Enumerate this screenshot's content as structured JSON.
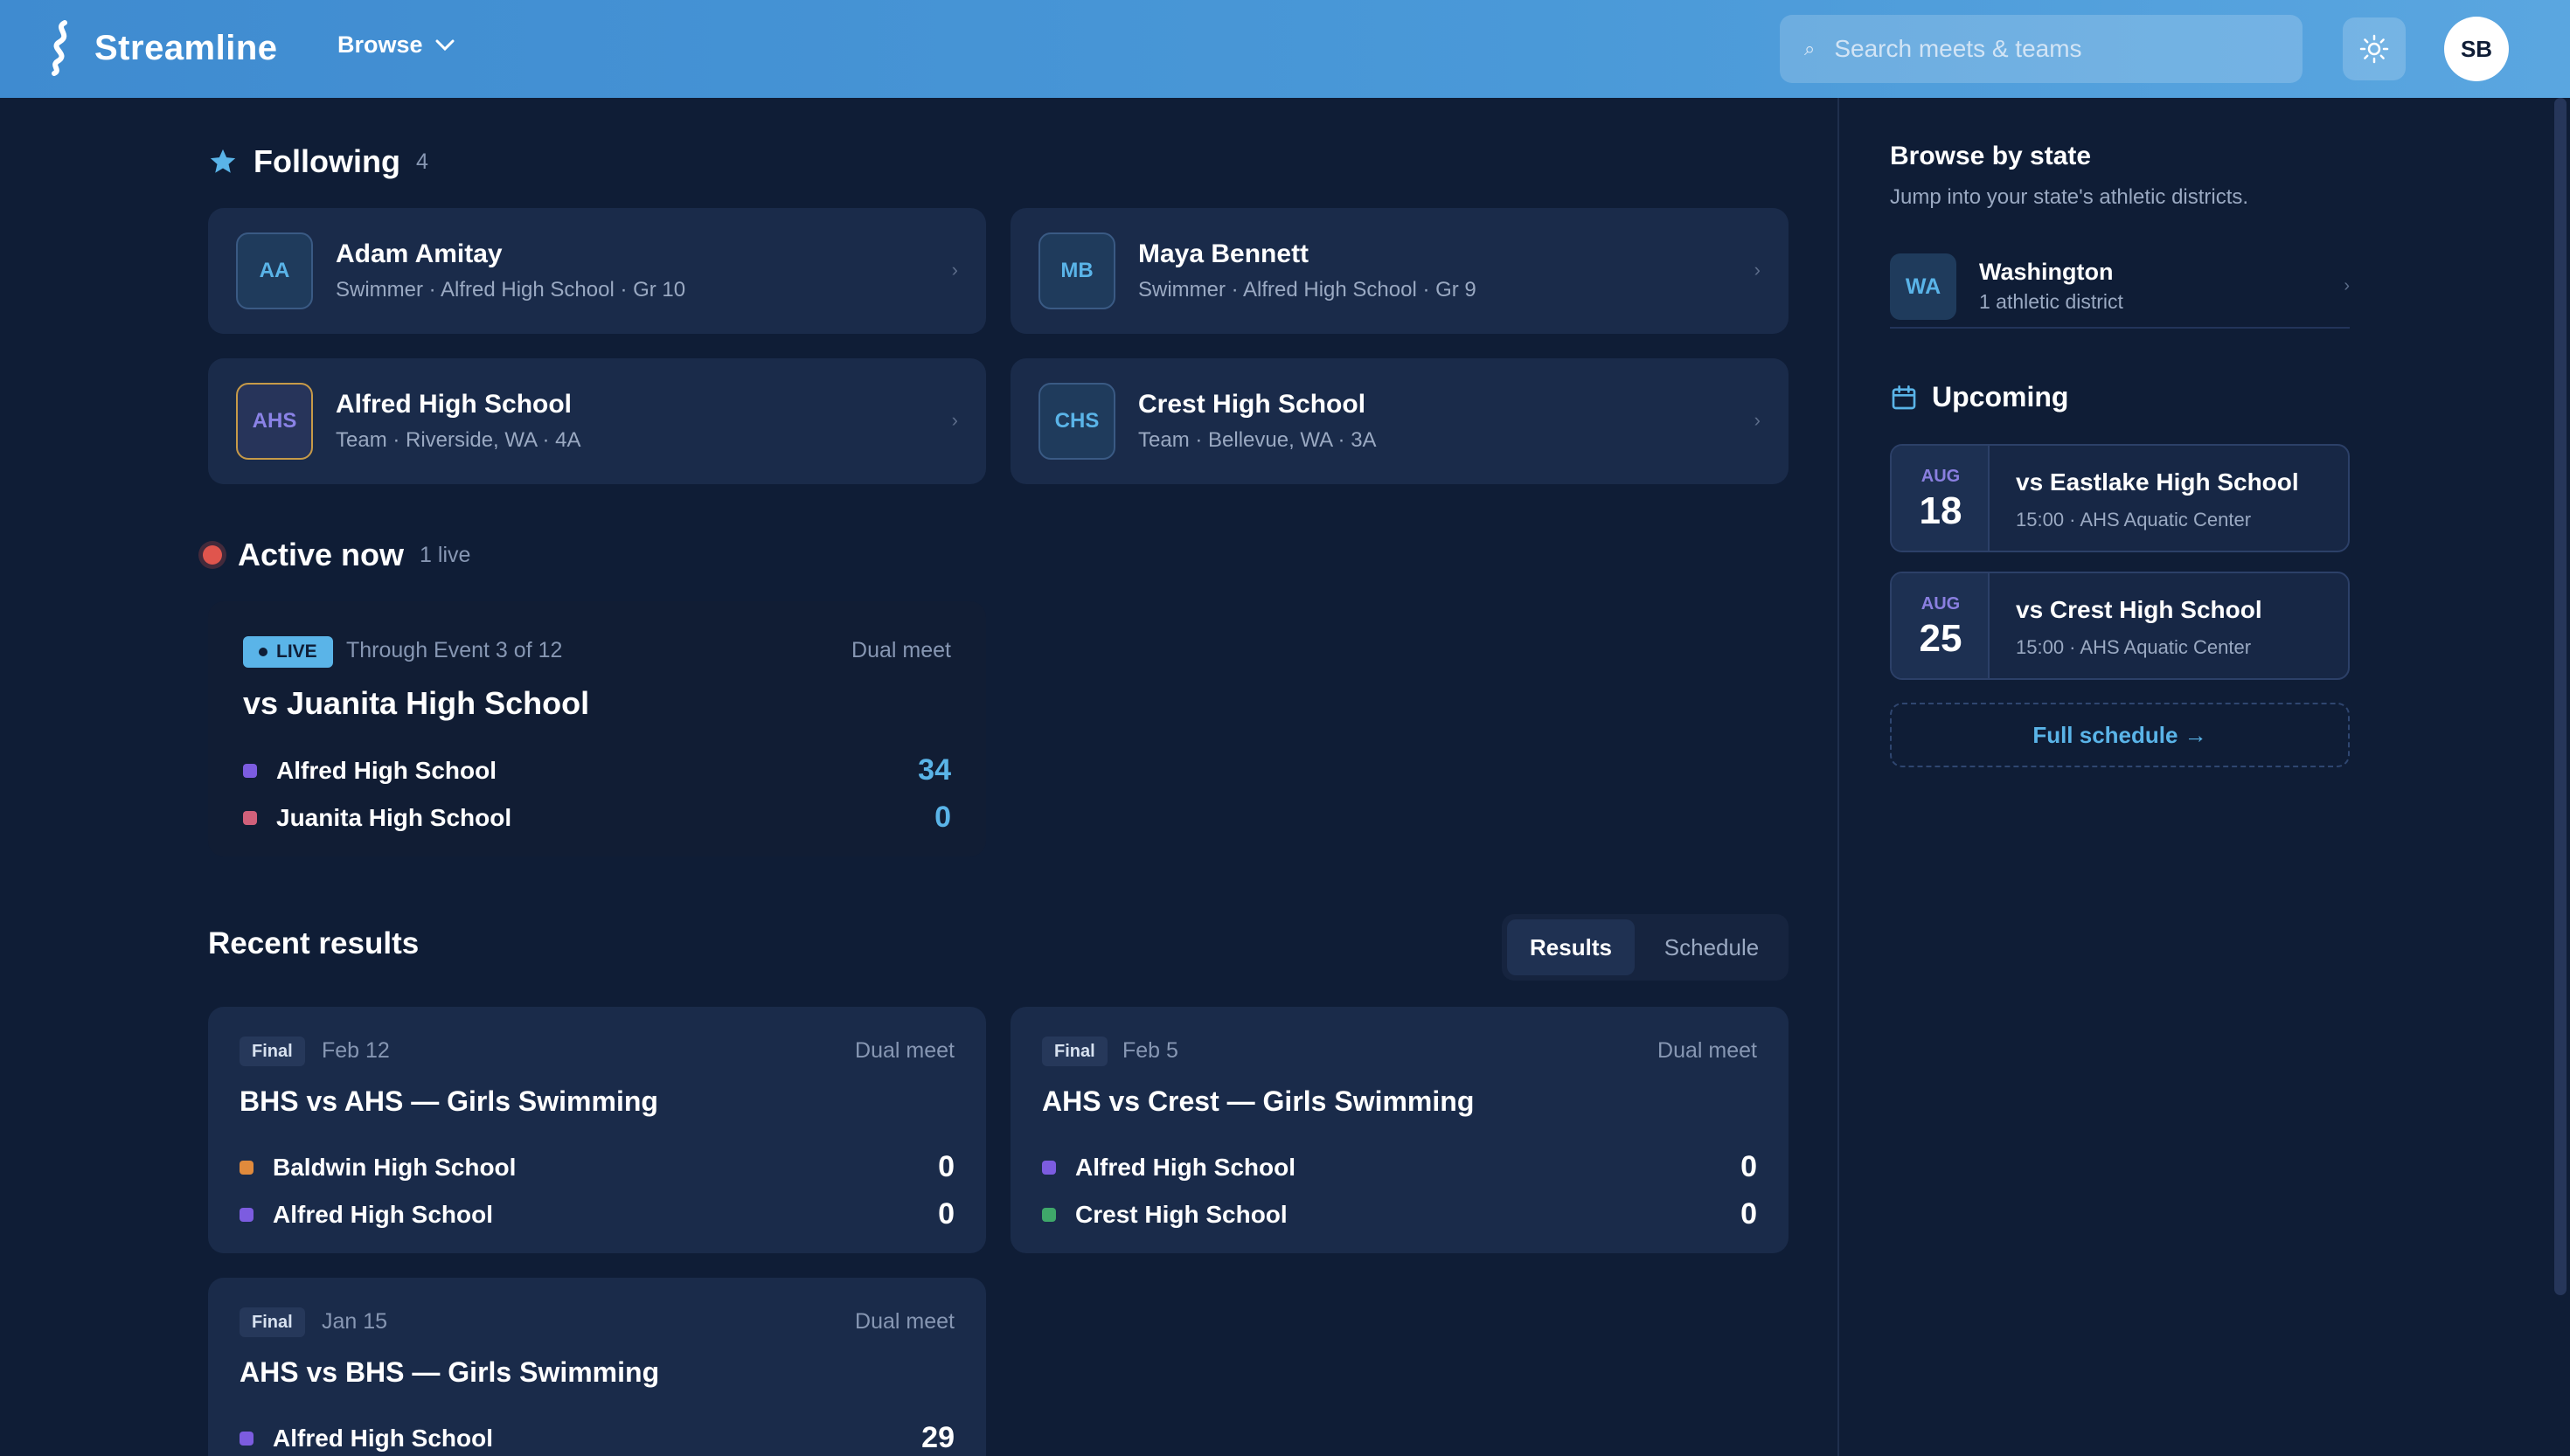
{
  "header": {
    "app_name": "Streamline",
    "browse_label": "Browse",
    "search_placeholder": "Search meets & teams",
    "user_initials": "SB"
  },
  "following": {
    "title": "Following",
    "count": "4",
    "items": [
      {
        "initials": "AA",
        "name": "Adam Amitay",
        "sub": "Swimmer · Alfred High School · Gr 10"
      },
      {
        "initials": "MB",
        "name": "Maya Bennett",
        "sub": "Swimmer · Alfred High School · Gr 9"
      },
      {
        "initials": "AHS",
        "name": "Alfred High School",
        "sub": "Team · Riverside, WA · 4A"
      },
      {
        "initials": "CHS",
        "name": "Crest High School",
        "sub": "Team · Bellevue, WA · 3A"
      }
    ]
  },
  "active": {
    "title": "Active now",
    "count": "1 live",
    "meet": {
      "live_label": "LIVE",
      "progress": "Through Event 3 of 12",
      "type": "Dual meet",
      "title": "vs Juanita High School",
      "teams": [
        {
          "name": "Alfred High School",
          "score": "34",
          "color": "#7c5ce0"
        },
        {
          "name": "Juanita High School",
          "score": "0",
          "color": "#d0607a"
        }
      ]
    }
  },
  "recent": {
    "title": "Recent results",
    "tabs": [
      "Results",
      "Schedule"
    ],
    "cards": [
      {
        "status": "Final",
        "date": "Feb 12",
        "type": "Dual meet",
        "title": "BHS vs AHS — Girls Swimming",
        "teams": [
          {
            "name": "Baldwin High School",
            "score": "0",
            "color": "#e08a3c"
          },
          {
            "name": "Alfred High School",
            "score": "0",
            "color": "#7c5ce0"
          }
        ]
      },
      {
        "status": "Final",
        "date": "Feb 5",
        "type": "Dual meet",
        "title": "AHS vs Crest — Girls Swimming",
        "teams": [
          {
            "name": "Alfred High School",
            "score": "0",
            "color": "#7c5ce0"
          },
          {
            "name": "Crest High School",
            "score": "0",
            "color": "#3fa86a"
          }
        ]
      },
      {
        "status": "Final",
        "date": "Jan 15",
        "type": "Dual meet",
        "title": "AHS vs BHS — Girls Swimming",
        "teams": [
          {
            "name": "Alfred High School",
            "score": "29",
            "color": "#7c5ce0"
          }
        ]
      }
    ]
  },
  "sidebar": {
    "browse_title": "Browse by state",
    "browse_sub": "Jump into your state's athletic districts.",
    "state": {
      "abbr": "WA",
      "name": "Washington",
      "sub": "1 athletic district"
    },
    "upcoming_title": "Upcoming",
    "upcoming": [
      {
        "month": "AUG",
        "day": "18",
        "title": "vs Eastlake High School",
        "sub": "15:00 · AHS Aquatic Center"
      },
      {
        "month": "AUG",
        "day": "25",
        "title": "vs Crest High School",
        "sub": "15:00 · AHS Aquatic Center"
      }
    ],
    "full_schedule": "Full schedule →"
  }
}
